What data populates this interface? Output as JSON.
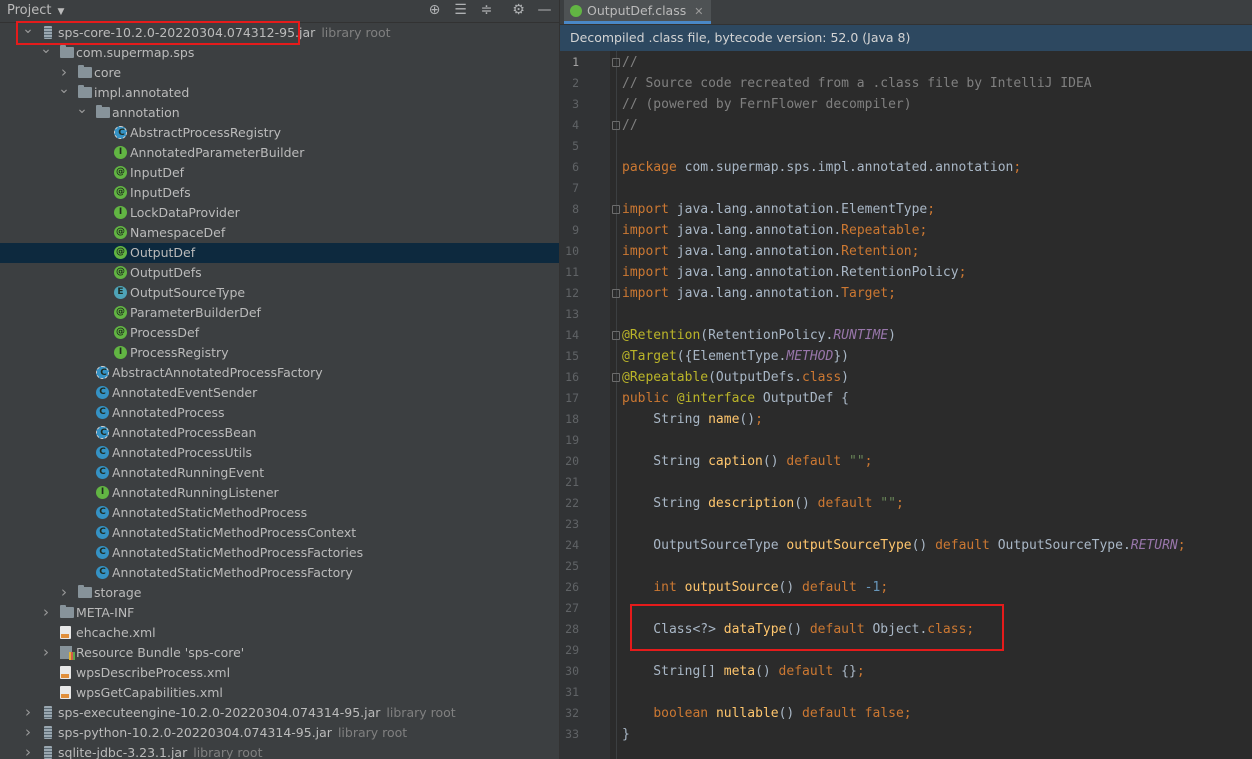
{
  "project_panel": {
    "title": "Project",
    "toolbar_icons": [
      "target-icon",
      "expand-all-icon",
      "collapse-all-icon",
      "gear-icon",
      "minimize-icon"
    ],
    "tree": [
      {
        "depth": 0,
        "arrow": "down",
        "icon": "jar",
        "label": "sps-core-10.2.0-20220304.074312-95.jar",
        "hint": "library root"
      },
      {
        "depth": 1,
        "arrow": "down",
        "icon": "package",
        "label": "com.supermap.sps"
      },
      {
        "depth": 2,
        "arrow": "right",
        "icon": "package",
        "label": "core"
      },
      {
        "depth": 2,
        "arrow": "down",
        "icon": "package",
        "label": "impl.annotated"
      },
      {
        "depth": 3,
        "arrow": "down",
        "icon": "package",
        "label": "annotation"
      },
      {
        "depth": 4,
        "icon": "abstract",
        "label": "AbstractProcessRegistry"
      },
      {
        "depth": 4,
        "icon": "interface",
        "label": "AnnotatedParameterBuilder"
      },
      {
        "depth": 4,
        "icon": "annotation",
        "label": "InputDef"
      },
      {
        "depth": 4,
        "icon": "annotation",
        "label": "InputDefs"
      },
      {
        "depth": 4,
        "icon": "interface",
        "label": "LockDataProvider"
      },
      {
        "depth": 4,
        "icon": "annotation",
        "label": "NamespaceDef"
      },
      {
        "depth": 4,
        "icon": "annotation",
        "label": "OutputDef",
        "selected": true
      },
      {
        "depth": 4,
        "icon": "annotation",
        "label": "OutputDefs"
      },
      {
        "depth": 4,
        "icon": "enum",
        "label": "OutputSourceType"
      },
      {
        "depth": 4,
        "icon": "annotation",
        "label": "ParameterBuilderDef"
      },
      {
        "depth": 4,
        "icon": "annotation",
        "label": "ProcessDef"
      },
      {
        "depth": 4,
        "icon": "interface",
        "label": "ProcessRegistry"
      },
      {
        "depth": 3,
        "icon": "abstract",
        "label": "AbstractAnnotatedProcessFactory"
      },
      {
        "depth": 3,
        "icon": "class",
        "label": "AnnotatedEventSender"
      },
      {
        "depth": 3,
        "icon": "class",
        "label": "AnnotatedProcess"
      },
      {
        "depth": 3,
        "icon": "abstract",
        "label": "AnnotatedProcessBean"
      },
      {
        "depth": 3,
        "icon": "class",
        "label": "AnnotatedProcessUtils"
      },
      {
        "depth": 3,
        "icon": "class",
        "label": "AnnotatedRunningEvent"
      },
      {
        "depth": 3,
        "icon": "interface",
        "label": "AnnotatedRunningListener"
      },
      {
        "depth": 3,
        "icon": "class",
        "label": "AnnotatedStaticMethodProcess"
      },
      {
        "depth": 3,
        "icon": "class",
        "label": "AnnotatedStaticMethodProcessContext"
      },
      {
        "depth": 3,
        "icon": "class",
        "label": "AnnotatedStaticMethodProcessFactories"
      },
      {
        "depth": 3,
        "icon": "class",
        "label": "AnnotatedStaticMethodProcessFactory"
      },
      {
        "depth": 2,
        "arrow": "right",
        "icon": "package",
        "label": "storage"
      },
      {
        "depth": 1,
        "arrow": "right",
        "icon": "folder",
        "label": "META-INF"
      },
      {
        "depth": 1,
        "icon": "xml",
        "label": "ehcache.xml"
      },
      {
        "depth": 1,
        "arrow": "right",
        "icon": "bundle",
        "label": "Resource Bundle 'sps-core'"
      },
      {
        "depth": 1,
        "icon": "xml",
        "label": "wpsDescribeProcess.xml"
      },
      {
        "depth": 1,
        "icon": "xml",
        "label": "wpsGetCapabilities.xml"
      },
      {
        "depth": 0,
        "arrow": "right",
        "icon": "jar",
        "label": "sps-executeengine-10.2.0-20220304.074314-95.jar",
        "hint": "library root"
      },
      {
        "depth": 0,
        "arrow": "right",
        "icon": "jar",
        "label": "sps-python-10.2.0-20220304.074314-95.jar",
        "hint": "library root"
      },
      {
        "depth": 0,
        "arrow": "right",
        "icon": "jar",
        "label": "sqlite-jdbc-3.23.1.jar",
        "hint": "library root"
      }
    ]
  },
  "editor": {
    "tab": {
      "label": "OutputDef.class",
      "icon": "annotation"
    },
    "banner": "Decompiled .class file, bytecode version: 52.0 (Java 8)",
    "current_line": 1,
    "lines": [
      [
        [
          "c",
          "//"
        ]
      ],
      [
        [
          "c",
          "// Source code recreated from a .class file by IntelliJ IDEA"
        ]
      ],
      [
        [
          "c",
          "// (powered by FernFlower decompiler)"
        ]
      ],
      [
        [
          "c",
          "//"
        ]
      ],
      [],
      [
        [
          "k",
          "package "
        ],
        [
          "p",
          "com.supermap.sps.impl.annotated.annotation"
        ],
        [
          "k",
          ";"
        ]
      ],
      [],
      [
        [
          "k",
          "import "
        ],
        [
          "p",
          "java.lang.annotation.ElementType"
        ],
        [
          "k",
          ";"
        ]
      ],
      [
        [
          "k",
          "import "
        ],
        [
          "p",
          "java.lang.annotation."
        ],
        [
          "k",
          "Repeatable"
        ],
        [
          "k",
          ";"
        ]
      ],
      [
        [
          "k",
          "import "
        ],
        [
          "p",
          "java.lang.annotation."
        ],
        [
          "k",
          "Retention"
        ],
        [
          "k",
          ";"
        ]
      ],
      [
        [
          "k",
          "import "
        ],
        [
          "p",
          "java.lang.annotation.RetentionPolicy"
        ],
        [
          "k",
          ";"
        ]
      ],
      [
        [
          "k",
          "import "
        ],
        [
          "p",
          "java.lang.annotation."
        ],
        [
          "k",
          "Target"
        ],
        [
          "k",
          ";"
        ]
      ],
      [],
      [
        [
          "an",
          "@Retention"
        ],
        [
          "p",
          "(RetentionPolicy."
        ],
        [
          "it",
          "RUNTIME"
        ],
        [
          "p",
          ")"
        ]
      ],
      [
        [
          "an",
          "@Target"
        ],
        [
          "p",
          "({ElementType."
        ],
        [
          "it",
          "METHOD"
        ],
        [
          "p",
          "})"
        ]
      ],
      [
        [
          "an",
          "@Repeatable"
        ],
        [
          "p",
          "(OutputDefs."
        ],
        [
          "k",
          "class"
        ],
        [
          "p",
          ")"
        ]
      ],
      [
        [
          "k",
          "public "
        ],
        [
          "an",
          "@interface "
        ],
        [
          "p",
          "OutputDef {"
        ]
      ],
      [
        [
          "p",
          "    String "
        ],
        [
          "fn",
          "name"
        ],
        [
          "p",
          "()"
        ],
        [
          "k",
          ";"
        ]
      ],
      [],
      [
        [
          "p",
          "    String "
        ],
        [
          "fn",
          "caption"
        ],
        [
          "p",
          "() "
        ],
        [
          "k",
          "default "
        ],
        [
          "st",
          "\"\""
        ],
        [
          "k",
          ";"
        ]
      ],
      [],
      [
        [
          "p",
          "    String "
        ],
        [
          "fn",
          "description"
        ],
        [
          "p",
          "() "
        ],
        [
          "k",
          "default "
        ],
        [
          "st",
          "\"\""
        ],
        [
          "k",
          ";"
        ]
      ],
      [],
      [
        [
          "p",
          "    OutputSourceType "
        ],
        [
          "fn",
          "outputSourceType"
        ],
        [
          "p",
          "() "
        ],
        [
          "k",
          "default "
        ],
        [
          "p",
          "OutputSourceType."
        ],
        [
          "it",
          "RETURN"
        ],
        [
          "k",
          ";"
        ]
      ],
      [],
      [
        [
          "p",
          "    "
        ],
        [
          "k",
          "int "
        ],
        [
          "fn",
          "outputSource"
        ],
        [
          "p",
          "() "
        ],
        [
          "k",
          "default "
        ],
        [
          "nm",
          "-1"
        ],
        [
          "k",
          ";"
        ]
      ],
      [],
      [
        [
          "p",
          "    Class<?> "
        ],
        [
          "fn",
          "dataType"
        ],
        [
          "p",
          "() "
        ],
        [
          "k",
          "default "
        ],
        [
          "p",
          "Object."
        ],
        [
          "k",
          "class"
        ],
        [
          "k",
          ";"
        ]
      ],
      [],
      [
        [
          "p",
          "    String[] "
        ],
        [
          "fn",
          "meta"
        ],
        [
          "p",
          "() "
        ],
        [
          "k",
          "default "
        ],
        [
          "p",
          "{}"
        ],
        [
          "k",
          ";"
        ]
      ],
      [],
      [
        [
          "p",
          "    "
        ],
        [
          "k",
          "boolean "
        ],
        [
          "fn",
          "nullable"
        ],
        [
          "p",
          "() "
        ],
        [
          "k",
          "default false"
        ],
        [
          "k",
          ";"
        ]
      ],
      [
        [
          "p",
          "}"
        ]
      ]
    ]
  }
}
